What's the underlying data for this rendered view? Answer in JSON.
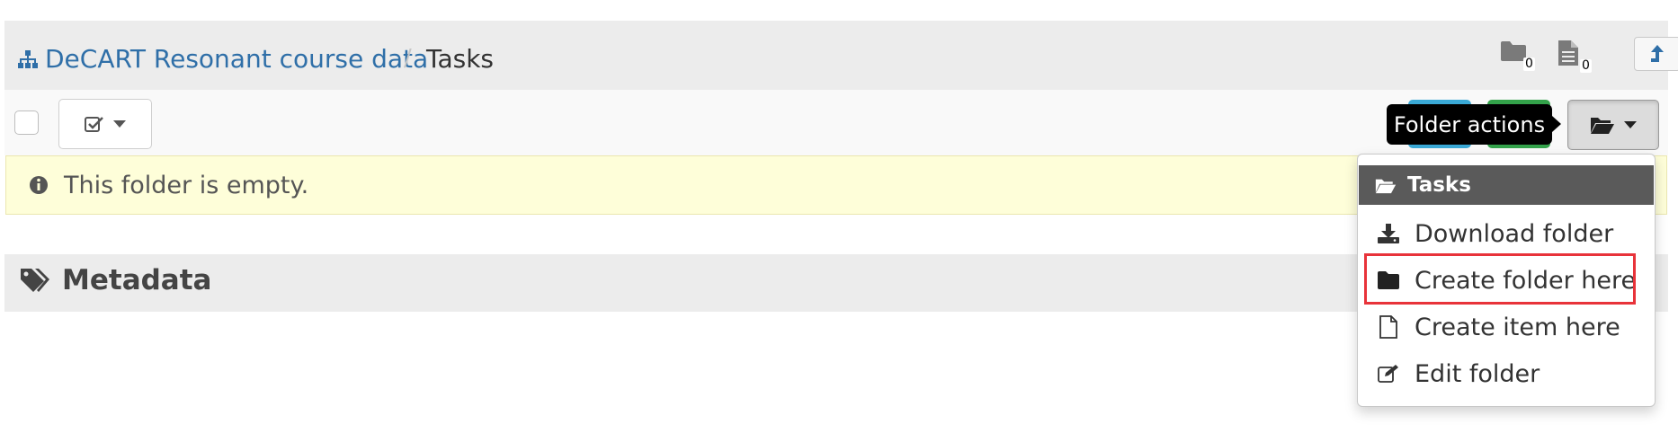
{
  "breadcrumb": {
    "root_label": "DeCART Resonant course data",
    "separator": "/",
    "current": "Tasks"
  },
  "counts": {
    "folders": "0",
    "items": "0"
  },
  "toolbar": {
    "tooltip": "Folder actions"
  },
  "notice": {
    "text": "This folder is empty."
  },
  "metadata": {
    "title": "Metadata"
  },
  "menu": {
    "header": "Tasks",
    "items": [
      {
        "label": "Download folder",
        "icon": "download-icon"
      },
      {
        "label": "Create folder here",
        "icon": "folder-icon"
      },
      {
        "label": "Create item here",
        "icon": "file-icon"
      },
      {
        "label": "Edit folder",
        "icon": "edit-icon"
      }
    ]
  },
  "colors": {
    "link": "#2f6fa8",
    "highlight": "#e8333a",
    "menu_header_bg": "#5a5a5a",
    "notice_bg": "#fefed9"
  }
}
